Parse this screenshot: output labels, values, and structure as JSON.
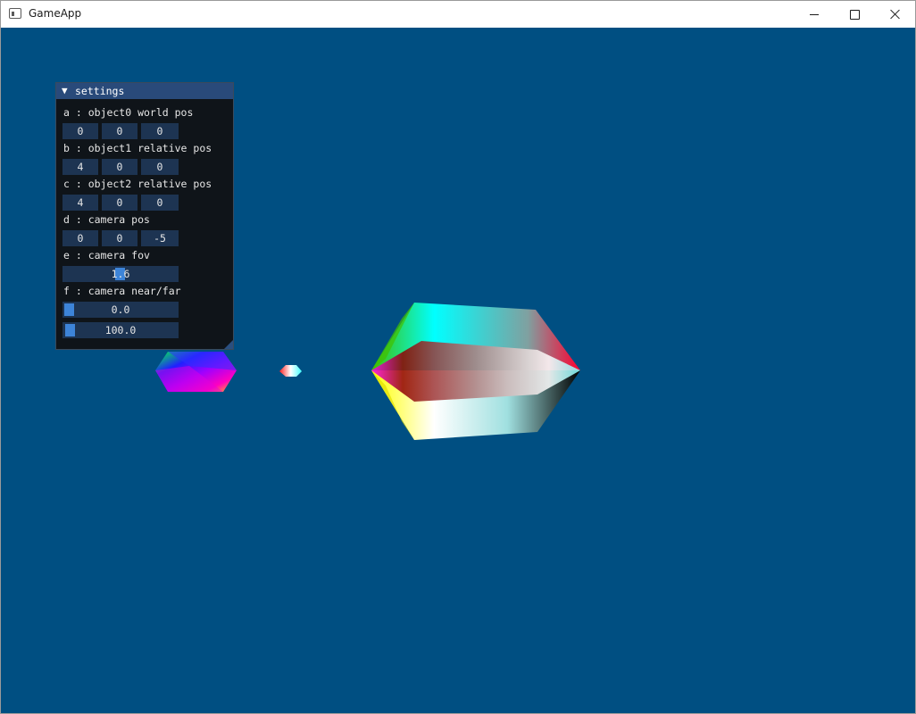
{
  "window": {
    "title": "GameApp",
    "background": "#004f82"
  },
  "settings": {
    "title": "settings",
    "collapse_icon": "triangle-down-icon",
    "object0_label": "a : object0 world pos",
    "object0_pos": [
      "0",
      "0",
      "0"
    ],
    "object1_label": "b : object1 relative pos",
    "object1_pos": [
      "4",
      "0",
      "0"
    ],
    "object2_label": "c : object2 relative pos",
    "object2_pos": [
      "4",
      "0",
      "0"
    ],
    "camera_pos_label": "d : camera pos",
    "camera_pos": [
      "0",
      "0",
      "-5"
    ],
    "camera_fov_label": "e : camera fov",
    "camera_fov": "1.6",
    "camera_nearfar_label": "f : camera near/far",
    "camera_near": "0.0",
    "camera_far": "100.0",
    "accent": "#3d84d8"
  }
}
